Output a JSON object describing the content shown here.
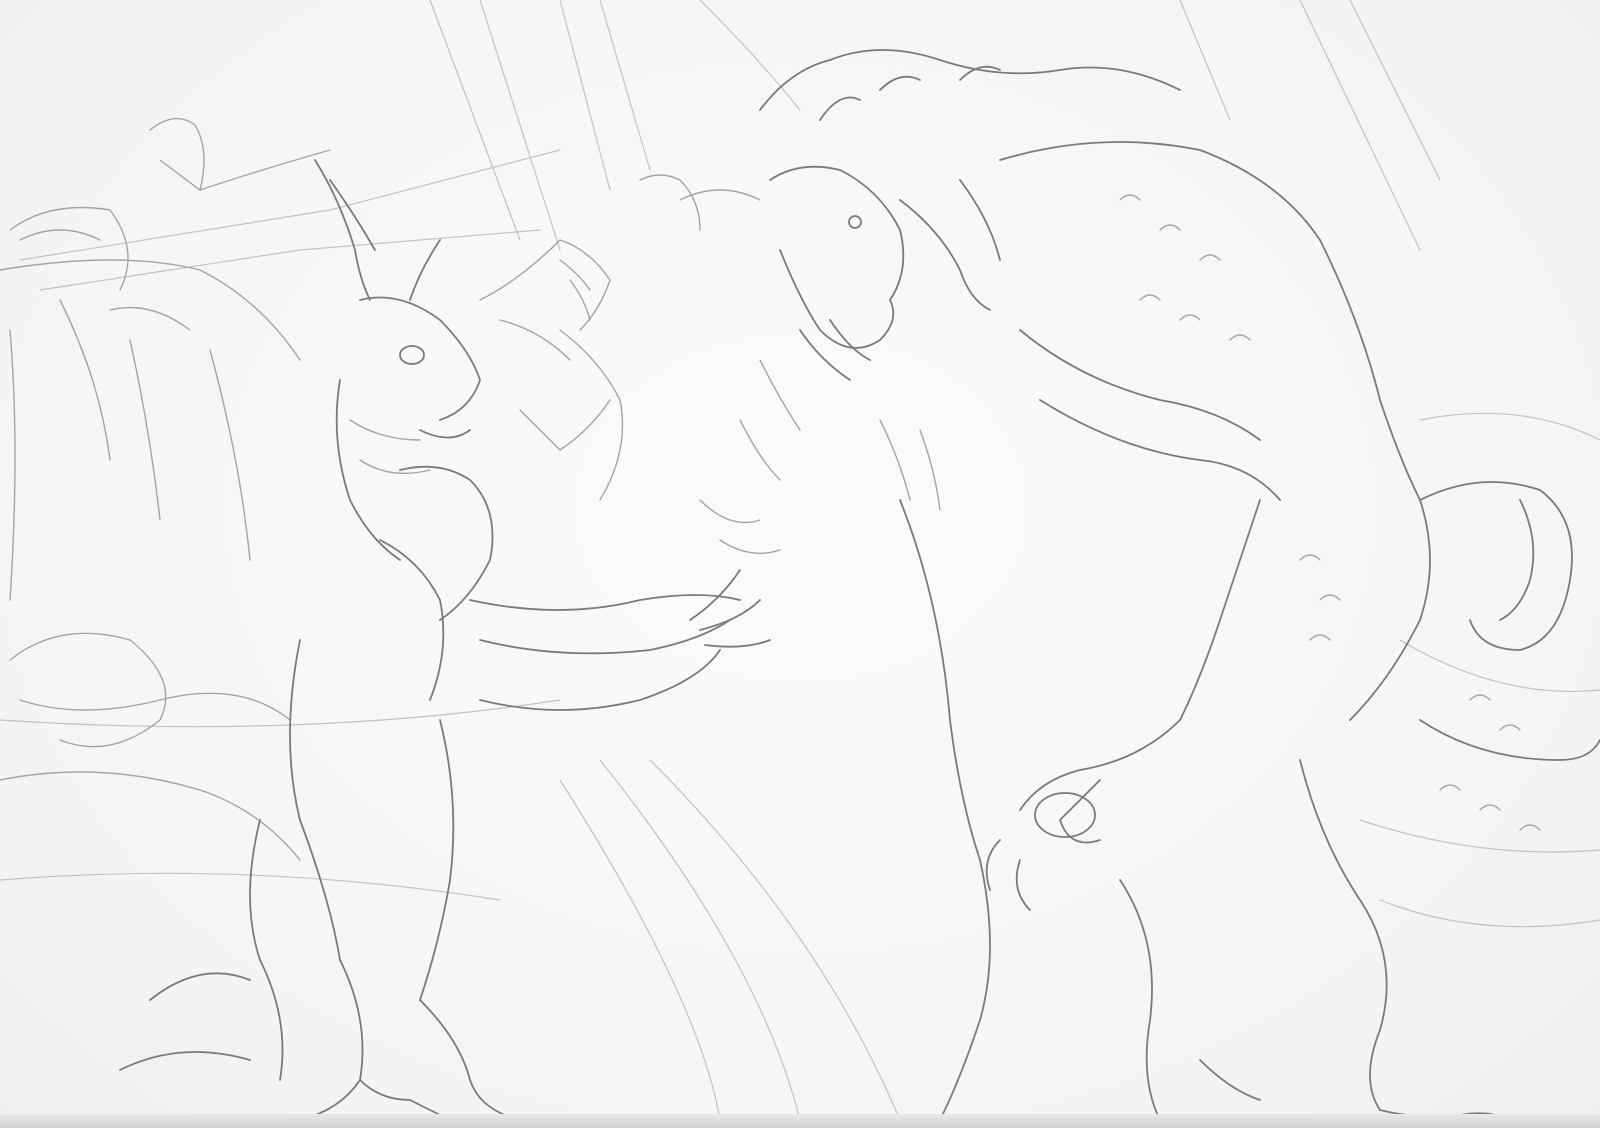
{
  "artwork": {
    "medium": "pencil-sketch",
    "subject_icons": [
      "left-dragon-figure-icon",
      "right-dragon-figure-icon"
    ],
    "paper_color": "#f6f6f6",
    "graphite_color": "#8d8d8d"
  }
}
